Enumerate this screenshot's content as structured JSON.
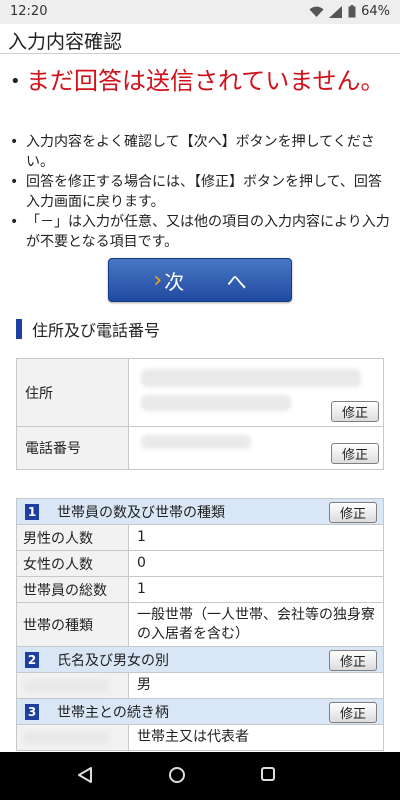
{
  "status": {
    "time": "12:20",
    "battery": "64%"
  },
  "header": {
    "title": "入力内容確認"
  },
  "notice": {
    "warning": "まだ回答は送信されていません。",
    "items": [
      "入力内容をよく確認して【次へ】ボタンを押してください。",
      "回答を修正する場合には、【修正】ボタンを押して、回答入力画面に戻ります。",
      "「－」は入力が任意、又は他の項目の入力内容により入力が不要となる項目です。"
    ]
  },
  "next_button": {
    "label": "次 へ"
  },
  "section": {
    "title": "住所及び電話番号"
  },
  "address": {
    "address_label": "住所",
    "phone_label": "電話番号",
    "edit_label": "修正"
  },
  "household": {
    "s1": {
      "num": "1",
      "title": "世帯員の数及び世帯の種類",
      "edit_label": "修正"
    },
    "rows": [
      {
        "k": "男性の人数",
        "v": "1"
      },
      {
        "k": "女性の人数",
        "v": "0"
      },
      {
        "k": "世帯員の総数",
        "v": "1"
      },
      {
        "k": "世帯の種類",
        "v": "一般世帯（一人世帯、会社等の独身寮の入居者を含む）"
      }
    ],
    "s2": {
      "num": "2",
      "title": "氏名及び男女の別",
      "edit_label": "修正",
      "value": "男"
    },
    "s3": {
      "num": "3",
      "title": "世帯主との続き柄",
      "edit_label": "修正",
      "value": "世帯主又は代表者"
    }
  }
}
